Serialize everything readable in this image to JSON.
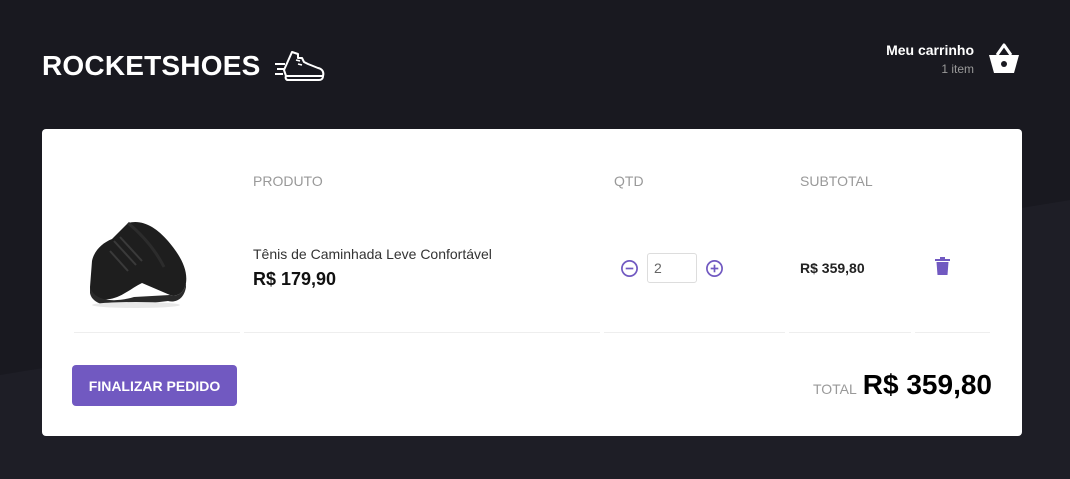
{
  "header": {
    "brand": "ROCKETSHOES",
    "cart_title": "Meu carrinho",
    "cart_count": "1 item"
  },
  "table": {
    "headers": {
      "product": "PRODUTO",
      "qty": "QTD",
      "subtotal": "SUBTOTAL"
    },
    "items": [
      {
        "title": "Tênis de Caminhada Leve Confortável",
        "price": "R$ 179,90",
        "quantity": "2",
        "subtotal": "R$ 359,80",
        "image": "black-sneaker"
      }
    ]
  },
  "footer": {
    "button_label": "FINALIZAR PEDIDO",
    "total_label": "TOTAL",
    "total_value": "R$ 359,80"
  },
  "colors": {
    "background": "#191920",
    "accent": "#7159c1",
    "panel": "#ffffff"
  },
  "icons": [
    "sneaker-logo-icon",
    "basket-icon",
    "minus-circle-icon",
    "plus-circle-icon",
    "trash-icon"
  ]
}
